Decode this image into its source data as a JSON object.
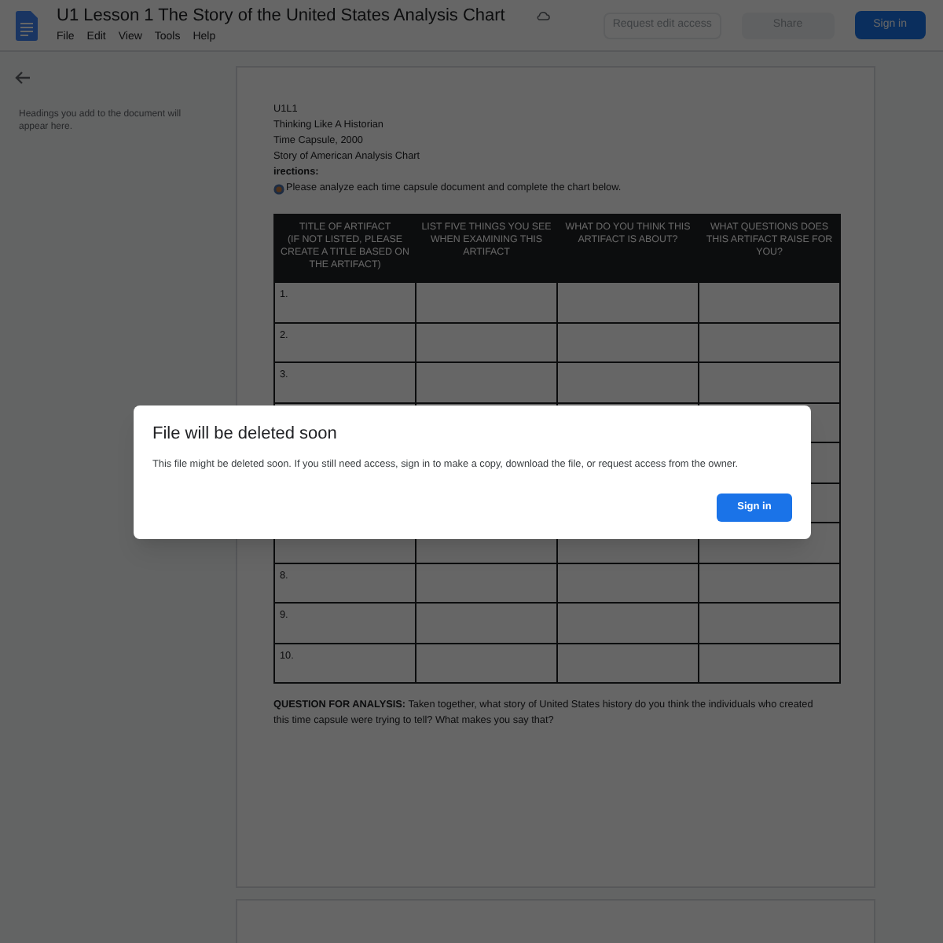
{
  "header": {
    "title": "U1 Lesson 1 The Story of the United States Analysis Chart",
    "menu": [
      "File",
      "Edit",
      "View",
      "Tools",
      "Help"
    ],
    "request_button": "Request edit access",
    "share_button": "Share",
    "sign_in_button": "Sign in"
  },
  "outline": {
    "hint": "Headings you add to the document will appear here."
  },
  "document": {
    "lines": [
      "U1L1",
      "Thinking Like A Historian",
      "Time Capsule, 2000",
      "Story of American Analysis Chart",
      "irections:"
    ],
    "instruction": "Please analyze each time capsule document and complete the chart below.",
    "table": {
      "columns": [
        "TITLE OF ARTIFACT\n(IF NOT LISTED, PLEASE CREATE A TITLE BASED ON THE ARTIFACT)",
        "LIST FIVE THINGS YOU SEE WHEN EXAMINING THIS ARTIFACT",
        "WHAT DO YOU THINK THIS ARTIFACT IS ABOUT?",
        "WHAT QUESTIONS DOES THIS ARTIFACT RAISE FOR YOU?"
      ],
      "rows": [
        {
          "label": "1."
        },
        {
          "label": "2."
        },
        {
          "label": "3."
        },
        {},
        {},
        {},
        {},
        {
          "label": "8."
        },
        {
          "label": "9."
        },
        {
          "label": "10."
        }
      ]
    },
    "question": "**QUESTION FOR ANALYSIS:** Taken together, what story of United States history do you think the individuals who created this time capsule were trying to tell? What makes you say that?"
  },
  "dialog": {
    "title": "File will be deleted soon",
    "message": "This file might be deleted soon. If you still need access, sign in to make a copy, download the file, or request access from the owner.",
    "button": "Sign in"
  }
}
